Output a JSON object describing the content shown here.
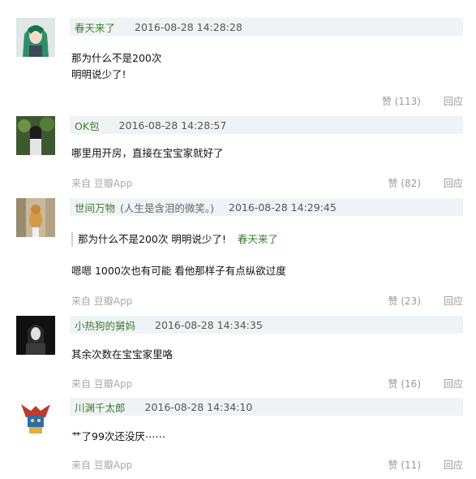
{
  "comments": [
    {
      "author": "春天来了",
      "time": "2016-08-28 14:28:28",
      "lines": [
        "那为什么不是200次",
        "明明说少了!"
      ],
      "source": "",
      "like": "赞 (113)",
      "reply": "回应"
    },
    {
      "author": "OK包",
      "time": "2016-08-28 14:28:57",
      "lines": [
        "哪里用开房，直接在宝宝家就好了"
      ],
      "source": "来自 豆瓣App",
      "like": "赞 (82)",
      "reply": "回应"
    },
    {
      "author": "世间万物",
      "author_note": "(人生是含泪的微笑。)",
      "time": "2016-08-28 14:29:45",
      "quote": {
        "text": "那为什么不是200次 明明说少了!",
        "author": "春天来了"
      },
      "lines": [
        "嗯嗯 1000次也有可能 看他那样子有点纵欲过度"
      ],
      "source": "来自 豆瓣App",
      "like": "赞 (23)",
      "reply": "回应"
    },
    {
      "author": "小热狗的舅妈",
      "time": "2016-08-28 14:34:35",
      "lines": [
        "其余次数在宝宝家里咯"
      ],
      "source": "来自 豆瓣App",
      "like": "赞 (16)",
      "reply": "回应"
    },
    {
      "author": "川渊千太郎",
      "time": "2016-08-28 14:34:10",
      "lines": [
        "艹了99次还没厌⋯⋯"
      ],
      "source": "来自 豆瓣App",
      "like": "赞 (11)",
      "reply": "回应"
    }
  ]
}
